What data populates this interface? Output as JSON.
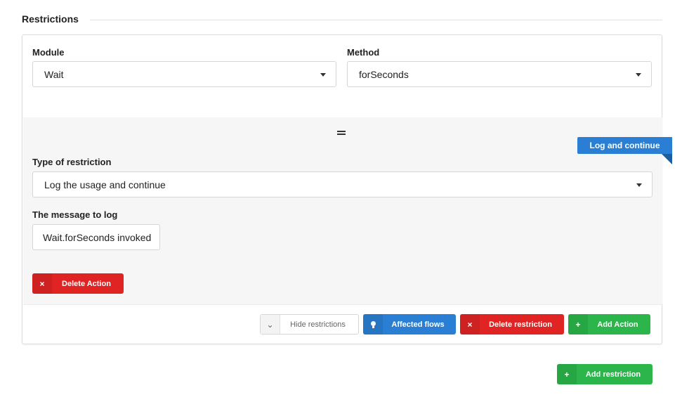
{
  "section": {
    "title": "Restrictions"
  },
  "module": {
    "label": "Module",
    "value": "Wait"
  },
  "method": {
    "label": "Method",
    "value": "forSeconds"
  },
  "action": {
    "ribbon": "Log and continue",
    "type_label": "Type of restriction",
    "type_value": "Log the usage and continue",
    "message_label": "The message to log",
    "message_value": "Wait.forSeconds invoked",
    "delete_action": "Delete Action"
  },
  "footer": {
    "hide_restrictions": "Hide restrictions",
    "affected_flows": "Affected flows",
    "delete_restriction": "Delete restriction",
    "add_action": "Add Action"
  },
  "add_restriction": "Add restriction",
  "icons": {
    "close": "×",
    "plus": "+",
    "chevron": "⌄",
    "bulb": "bulb-icon"
  },
  "colors": {
    "danger": "#e02424",
    "primary": "#2a7fd4",
    "success": "#2bb54a"
  }
}
